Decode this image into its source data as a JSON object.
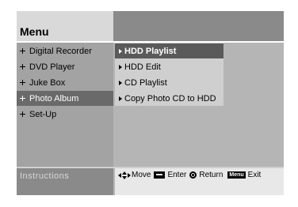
{
  "menu": {
    "title": "Menu"
  },
  "left_menu": [
    {
      "label": "Digital Recorder",
      "icon": "plus-bullet-icon",
      "active": false
    },
    {
      "label": "DVD Player",
      "icon": "plus-bullet-icon",
      "active": false
    },
    {
      "label": "Juke Box",
      "icon": "plus-bullet-icon",
      "active": false
    },
    {
      "label": "Photo Album",
      "icon": "plus-bullet-icon",
      "active": true
    },
    {
      "label": "Set-Up",
      "icon": "plus-bullet-icon",
      "active": false
    }
  ],
  "submenu": [
    {
      "label": "HDD Playlist",
      "icon": "arrow-bullet-icon",
      "selected": true
    },
    {
      "label": "HDD Edit",
      "icon": "arrow-bullet-icon",
      "selected": false
    },
    {
      "label": "CD Playlist",
      "icon": "arrow-bullet-icon",
      "selected": false
    },
    {
      "label": "Copy Photo CD to HDD",
      "icon": "arrow-bullet-icon",
      "selected": false
    }
  ],
  "instructions": {
    "label": "Instructions",
    "move_label": "Move",
    "enter_label": "Enter",
    "return_label": "Return",
    "menu_key_label": "Menu",
    "exit_label": "Exit"
  },
  "colors": {
    "left_active_bg": "#6a6a6a",
    "submenu_selected_bg": "#5a5a5a",
    "screen_bg": "#b5b5b5"
  }
}
